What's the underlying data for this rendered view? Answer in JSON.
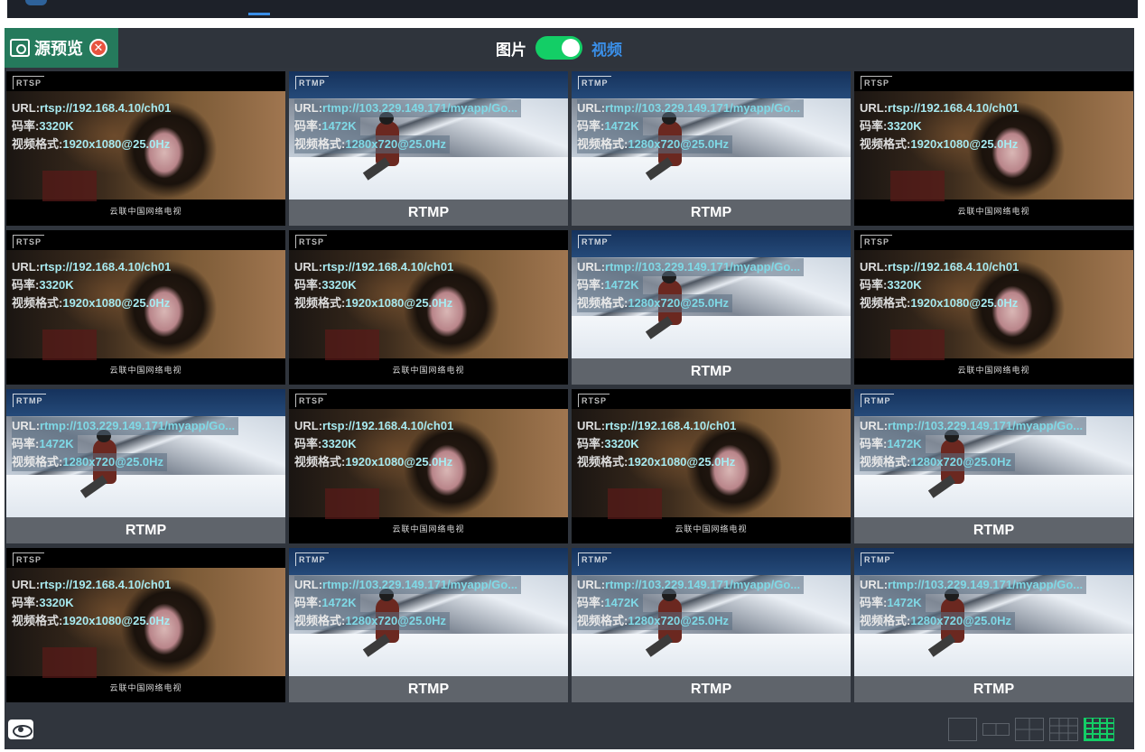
{
  "header": {
    "source_tab_label": "源预览",
    "mode_image_label": "图片",
    "mode_video_label": "视频",
    "mode_toggle_on": true
  },
  "tiles": [
    {
      "type": "rtsp",
      "tag": "RTSP",
      "url": "rtsp://192.168.4.10/ch01",
      "bitrate": "3320K",
      "format": "1920x1080@25.0Hz",
      "caption": "云联中国网络电视"
    },
    {
      "type": "rtmp",
      "tag": "RTMP",
      "url": "rtmp://103.229.149.171/myapp/Go...",
      "bitrate": "1472K",
      "format": "1280x720@25.0Hz",
      "caption": "RTMP"
    },
    {
      "type": "rtmp",
      "tag": "RTMP",
      "url": "rtmp://103.229.149.171/myapp/Go...",
      "bitrate": "1472K",
      "format": "1280x720@25.0Hz",
      "caption": "RTMP"
    },
    {
      "type": "rtsp",
      "tag": "RTSP",
      "url": "rtsp://192.168.4.10/ch01",
      "bitrate": "3320K",
      "format": "1920x1080@25.0Hz",
      "caption": "云联中国网络电视"
    },
    {
      "type": "rtsp",
      "tag": "RTSP",
      "url": "rtsp://192.168.4.10/ch01",
      "bitrate": "3320K",
      "format": "1920x1080@25.0Hz",
      "caption": "云联中国网络电视"
    },
    {
      "type": "rtsp",
      "tag": "RTSP",
      "url": "rtsp://192.168.4.10/ch01",
      "bitrate": "3320K",
      "format": "1920x1080@25.0Hz",
      "caption": "云联中国网络电视"
    },
    {
      "type": "rtmp",
      "tag": "RTMP",
      "url": "rtmp://103.229.149.171/myapp/Go...",
      "bitrate": "1472K",
      "format": "1280x720@25.0Hz",
      "caption": "RTMP"
    },
    {
      "type": "rtsp",
      "tag": "RTSP",
      "url": "rtsp://192.168.4.10/ch01",
      "bitrate": "3320K",
      "format": "1920x1080@25.0Hz",
      "caption": "云联中国网络电视"
    },
    {
      "type": "rtmp",
      "tag": "RTMP",
      "url": "rtmp://103.229.149.171/myapp/Go...",
      "bitrate": "1472K",
      "format": "1280x720@25.0Hz",
      "caption": "RTMP"
    },
    {
      "type": "rtsp",
      "tag": "RTSP",
      "url": "rtsp://192.168.4.10/ch01",
      "bitrate": "3320K",
      "format": "1920x1080@25.0Hz",
      "caption": "云联中国网络电视"
    },
    {
      "type": "rtsp",
      "tag": "RTSP",
      "url": "rtsp://192.168.4.10/ch01",
      "bitrate": "3320K",
      "format": "1920x1080@25.0Hz",
      "caption": "云联中国网络电视"
    },
    {
      "type": "rtmp",
      "tag": "RTMP",
      "url": "rtmp://103.229.149.171/myapp/Go...",
      "bitrate": "1472K",
      "format": "1280x720@25.0Hz",
      "caption": "RTMP"
    },
    {
      "type": "rtsp",
      "tag": "RTSP",
      "url": "rtsp://192.168.4.10/ch01",
      "bitrate": "3320K",
      "format": "1920x1080@25.0Hz",
      "caption": "云联中国网络电视"
    },
    {
      "type": "rtmp",
      "tag": "RTMP",
      "url": "rtmp://103.229.149.171/myapp/Go...",
      "bitrate": "1472K",
      "format": "1280x720@25.0Hz",
      "caption": "RTMP"
    },
    {
      "type": "rtmp",
      "tag": "RTMP",
      "url": "rtmp://103.229.149.171/myapp/Go...",
      "bitrate": "1472K",
      "format": "1280x720@25.0Hz",
      "caption": "RTMP"
    },
    {
      "type": "rtmp",
      "tag": "RTMP",
      "url": "rtmp://103.229.149.171/myapp/Go...",
      "bitrate": "1472K",
      "format": "1280x720@25.0Hz",
      "caption": "RTMP"
    }
  ],
  "labels": {
    "url_prefix": "URL:",
    "bitrate_prefix": "码率:",
    "format_prefix": "视频格式:"
  },
  "footer": {
    "layouts": [
      "layout-1-icon",
      "layout-2-icon",
      "layout-4-icon",
      "layout-9-icon",
      "layout-16-icon"
    ],
    "active_layout": "layout-16-icon"
  },
  "colors": {
    "accent_green": "#13ce66",
    "accent_blue": "#3a8ee6",
    "source_tab_bg": "#257a5c",
    "close_red": "#e8533f",
    "panel_bg": "#30353d"
  }
}
